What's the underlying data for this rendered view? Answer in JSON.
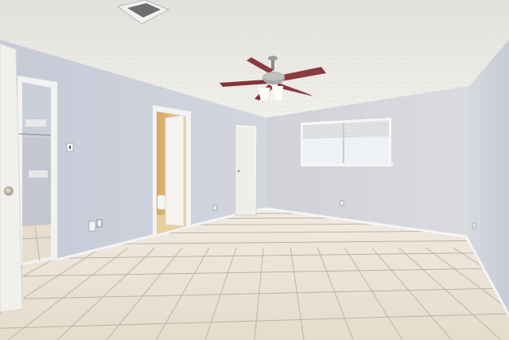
{
  "scene": {
    "description_free": true,
    "palette": {
      "ceiling": "#ece9e4",
      "wall_left": "#cfd3de",
      "wall_back": "#d6d7dc",
      "wall_right": "#d2d4dc",
      "floor": "#eee7dc",
      "grout": "#b9b2a8",
      "trim": "#f4f4f4",
      "door": "#f1f0ec",
      "fan_blade": "#8a3b3e",
      "fan_metal": "#9c9c9c",
      "window_glass": "#eef2f4",
      "bath_wall": "#e9c98c"
    },
    "icons": [
      "ceiling-fan-icon",
      "air-vent-icon",
      "light-switch-icon",
      "outlet-icon",
      "door-knob-icon"
    ]
  }
}
